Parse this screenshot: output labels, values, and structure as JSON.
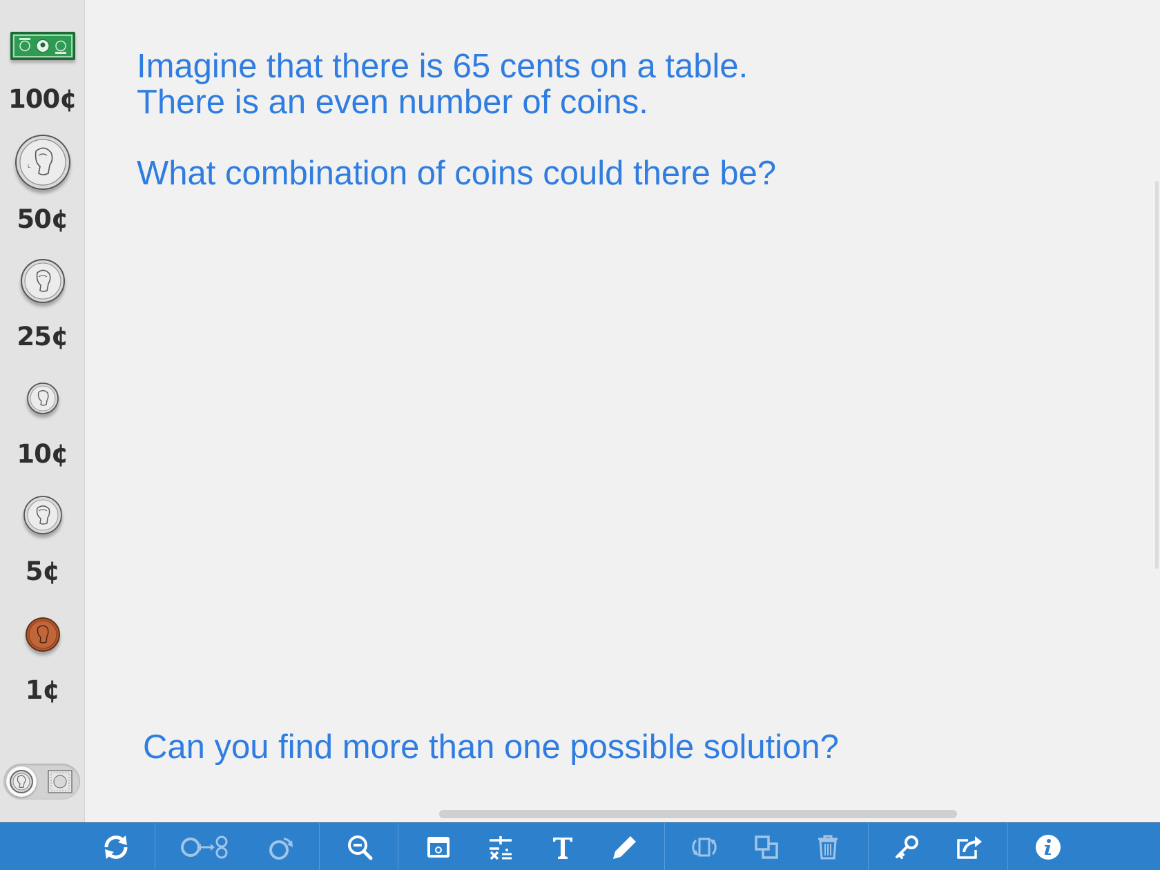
{
  "sidebar": {
    "items": [
      {
        "label": "100¢",
        "kind": "bill"
      },
      {
        "label": "50¢",
        "kind": "half-dollar"
      },
      {
        "label": "25¢",
        "kind": "quarter"
      },
      {
        "label": "10¢",
        "kind": "dime"
      },
      {
        "label": "5¢",
        "kind": "nickel"
      },
      {
        "label": "1¢",
        "kind": "penny"
      }
    ],
    "view_toggle": {
      "options": [
        "coin-face-icon",
        "coin-grid-icon"
      ],
      "selected": "coin-face-icon"
    }
  },
  "workspace": {
    "prompt_lines": [
      "Imagine that there is 65 cents on a table.",
      "There is an even number of coins."
    ],
    "question": "What combination of coins could there be?",
    "followup": "Can you find more than one possible solution?"
  },
  "toolbar": {
    "groups": [
      [
        "refresh-icon"
      ],
      [
        "exchange-coins-icon",
        "flip-coin-icon"
      ],
      [
        "zoom-out-icon"
      ],
      [
        "value-cover-icon",
        "math-operators-icon",
        "text-tool-icon",
        "pencil-icon"
      ],
      [
        "rotate-selection-icon",
        "duplicate-icon",
        "trash-icon"
      ],
      [
        "key-icon",
        "share-icon"
      ],
      [
        "info-icon"
      ]
    ]
  },
  "colors": {
    "text_blue": "#2f7de1",
    "toolbar_blue": "#2d80cc",
    "sidebar_bg": "#e3e3e3",
    "workspace_bg": "#f1f1f1",
    "bill_green": "#2f9a52",
    "penny_copper": "#b0552a",
    "silver": "#d6d6d6"
  }
}
